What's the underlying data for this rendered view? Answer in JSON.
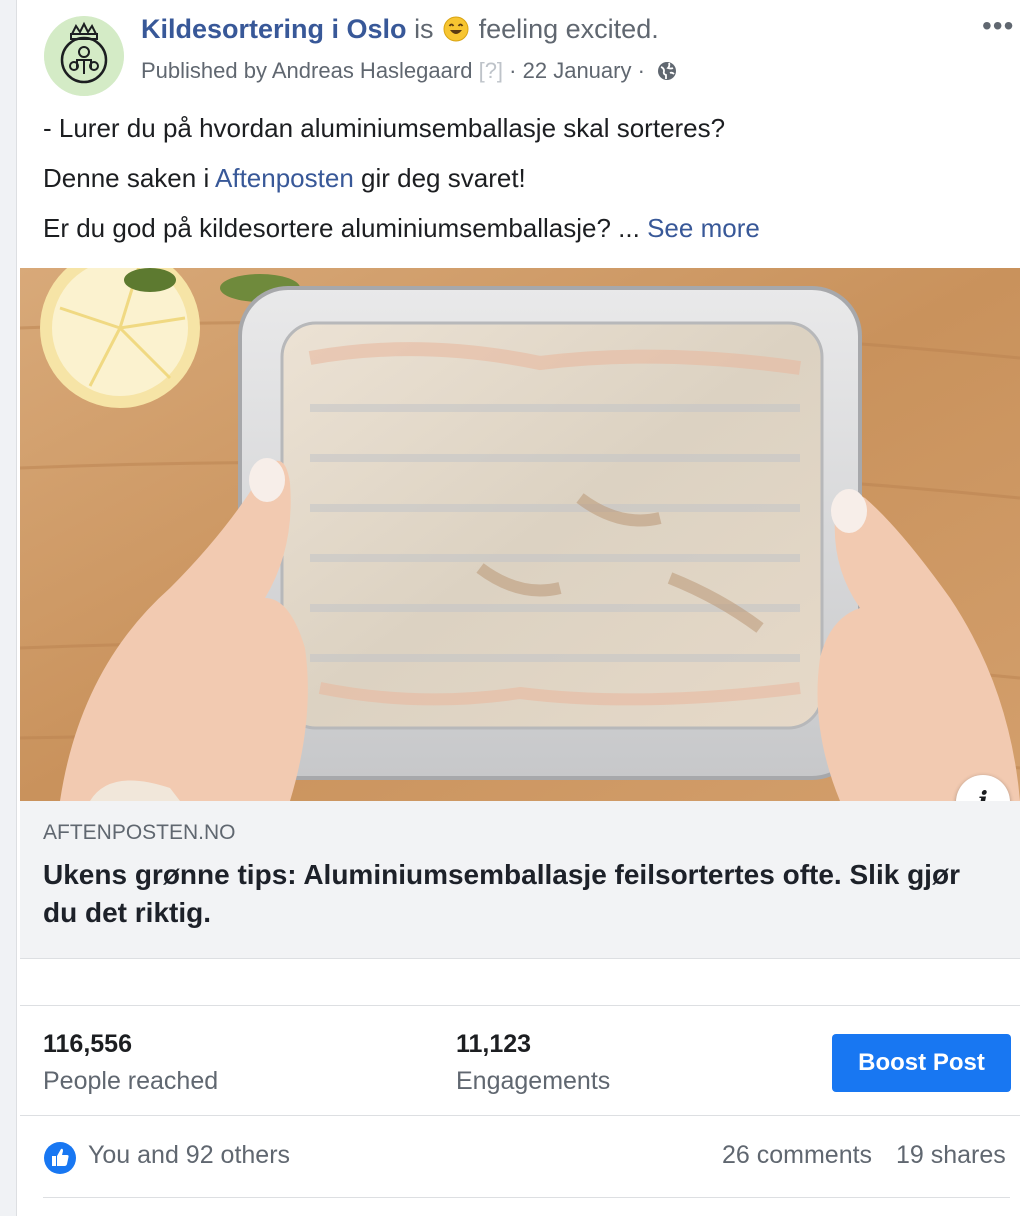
{
  "header": {
    "page_name": "Kildesortering i Oslo",
    "is_text": "is",
    "feeling": "feeling excited.",
    "published_by": "Published by Andreas Haslegaard",
    "help_marker": "[?]",
    "separator": "·",
    "date": "22 January",
    "more_label": "•••"
  },
  "post": {
    "line1": "- Lurer du på hvordan aluminiumsemballasje skal sorteres?",
    "line2_prefix": "Denne saken i ",
    "line2_link": "Aftenposten",
    "line2_suffix": " gir deg svaret!",
    "line3": "Er du god på kildesortere aluminiumsemballasje? ... ",
    "see_more": "See more"
  },
  "link_preview": {
    "domain": "AFTENPOSTEN.NO",
    "title": "Ukens grønne tips: Aluminiumsemballasje feilsortertes ofte. Slik gjør du det riktig.",
    "info_label": "i"
  },
  "stats": {
    "reach_value": "116,556",
    "reach_label": "People reached",
    "engagements_value": "11,123",
    "engagements_label": "Engagements",
    "boost_label": "Boost Post"
  },
  "reactions": {
    "summary": "You and 92 others",
    "comments": "26 comments",
    "shares": "19 shares"
  },
  "colors": {
    "link": "#385898",
    "boost": "#1877f2",
    "secondary_text": "#606770"
  },
  "icons": [
    "kildesortering-logo-icon",
    "smile-emoji-icon",
    "globe-icon",
    "more-options-icon",
    "info-icon",
    "like-icon"
  ]
}
